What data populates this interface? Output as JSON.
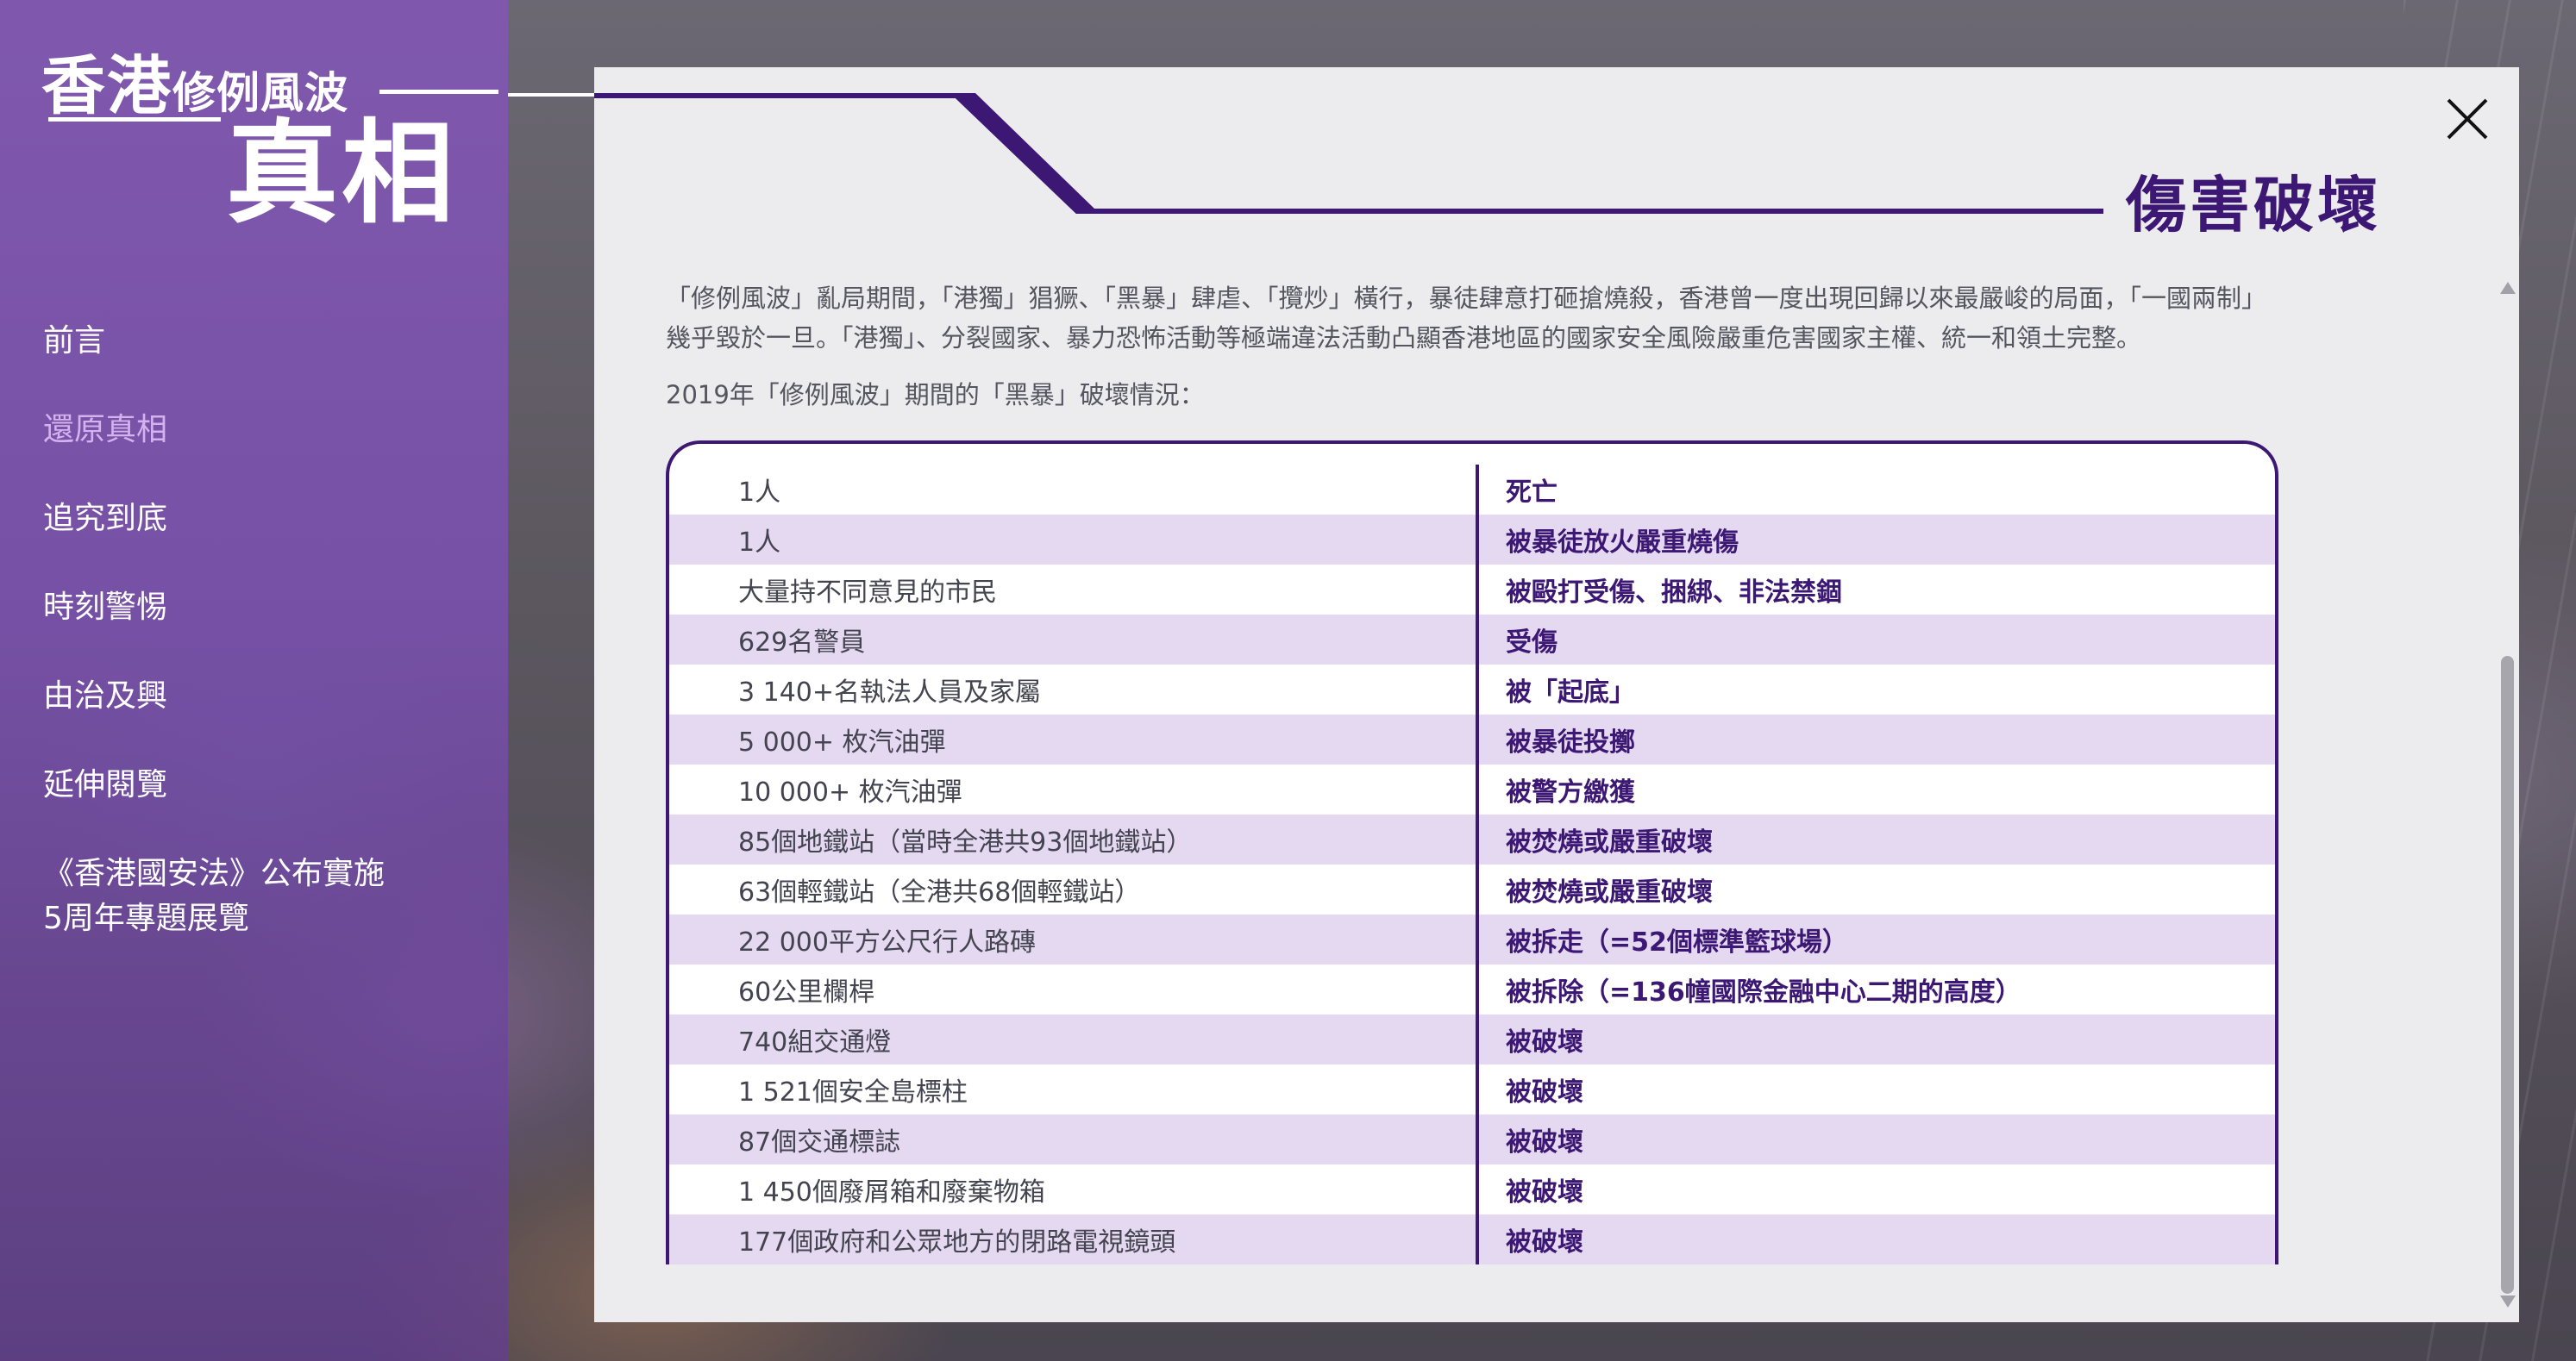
{
  "logo": {
    "line1_big": "香港",
    "line1_small": "修例風波",
    "line2": "真相"
  },
  "nav": {
    "items": [
      {
        "label": "前言",
        "active": false
      },
      {
        "label": "還原真相",
        "active": true
      },
      {
        "label": "追究到底",
        "active": false
      },
      {
        "label": "時刻警惕",
        "active": false
      },
      {
        "label": "由治及興",
        "active": false
      },
      {
        "label": "延伸閱覽",
        "active": false
      }
    ],
    "special": {
      "line1": "《香港國安法》公布實施",
      "line2": "5周年專題展覽"
    }
  },
  "modal": {
    "title": "傷害破壞",
    "close_icon": "close-icon",
    "intro": "「修例風波」亂局期間，「港獨」猖獗、「黑暴」肆虐、「攬炒」橫行，暴徒肆意打砸搶燒殺，香港曾一度出現回歸以來最嚴峻的局面，「一國兩制」幾乎毀於一旦。「港獨」、分裂國家、暴力恐怖活動等極端違法活動凸顯香港地區的國家安全風險嚴重危害國家主權、統一和領土完整。",
    "table_heading": "2019年「修例風波」期間的「黑暴」破壞情況：",
    "rows": [
      {
        "left": "1人",
        "right": "死亡"
      },
      {
        "left": "1人",
        "right": "被暴徒放火嚴重燒傷"
      },
      {
        "left": "大量持不同意見的市民",
        "right": "被毆打受傷、捆綁、非法禁錮"
      },
      {
        "left": "629名警員",
        "right": "受傷"
      },
      {
        "left": "3 140+名執法人員及家屬",
        "right": "被「起底」"
      },
      {
        "left": "5 000+ 枚汽油彈",
        "right": "被暴徒投擲"
      },
      {
        "left": "10 000+ 枚汽油彈",
        "right": "被警方繳獲"
      },
      {
        "left": "85個地鐵站（當時全港共93個地鐵站）",
        "right": "被焚燒或嚴重破壞"
      },
      {
        "left": "63個輕鐵站（全港共68個輕鐵站）",
        "right": "被焚燒或嚴重破壞"
      },
      {
        "left": "22 000平方公尺行人路磚",
        "right": "被拆走（=52個標準籃球場）"
      },
      {
        "left": "60公里欄桿",
        "right": "被拆除（=136幢國際金融中心二期的高度）"
      },
      {
        "left": "740組交通燈",
        "right": "被破壞"
      },
      {
        "left": "1 521個安全島標柱",
        "right": "被破壞"
      },
      {
        "left": "87個交通標誌",
        "right": "被破壞"
      },
      {
        "left": "1 450個廢屑箱和廢棄物箱",
        "right": "被破壞"
      },
      {
        "left": "177個政府和公眾地方的閉路電視鏡頭",
        "right": "被破壞"
      }
    ]
  },
  "colors": {
    "accent": "#3c1874",
    "sidebar": "#7f58b0",
    "active_nav": "#d4b2ee",
    "row_alt": "#e4d9f1",
    "modal_bg": "#ececee"
  }
}
